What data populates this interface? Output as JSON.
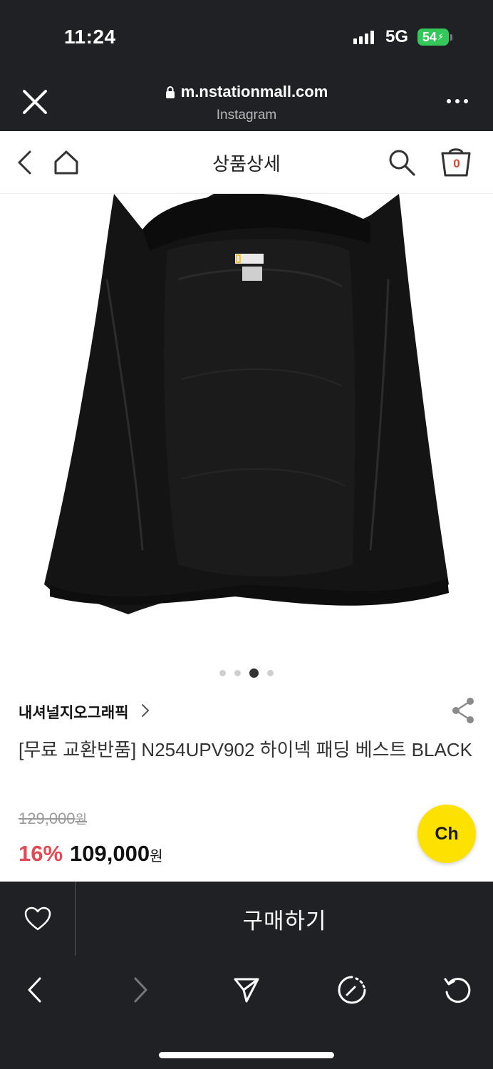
{
  "status_bar": {
    "time": "11:24",
    "network": "5G",
    "battery": "54"
  },
  "browser": {
    "url": "m.nstationmall.com",
    "source": "Instagram",
    "close_icon": "close-icon",
    "menu_icon": "more-icon"
  },
  "site_header": {
    "title": "상품상세",
    "cart_count": "0",
    "icons": [
      "back-icon",
      "home-icon",
      "search-icon",
      "cart-icon"
    ]
  },
  "gallery": {
    "image_alt": "black padded vest, inside view",
    "total_slides": 4,
    "active_slide": 3,
    "garment_label_text": "NATIONAL GEOGRAPHIC"
  },
  "product": {
    "brand": "내셔널지오그래픽",
    "name": "[무료 교환반품] N254UPV902 하이넥 패딩 베스트 BLACK",
    "original_price": "129,000",
    "original_price_unit": "원",
    "discount": "16%",
    "price": "109,000",
    "price_unit": "원",
    "chat_label": "Ch"
  },
  "buy_bar": {
    "wish_icon": "heart-icon",
    "buy_label": "구매하기"
  },
  "toolbar": {
    "icons": [
      "back-arrow-icon",
      "forward-arrow-icon",
      "send-icon",
      "speed-icon",
      "refresh-icon"
    ]
  },
  "colors": {
    "dark_bar": "#1f2124",
    "discount": "#e24b55",
    "chat_button": "#fde100",
    "battery": "#34c759",
    "cart_badge": "#e0442b"
  }
}
